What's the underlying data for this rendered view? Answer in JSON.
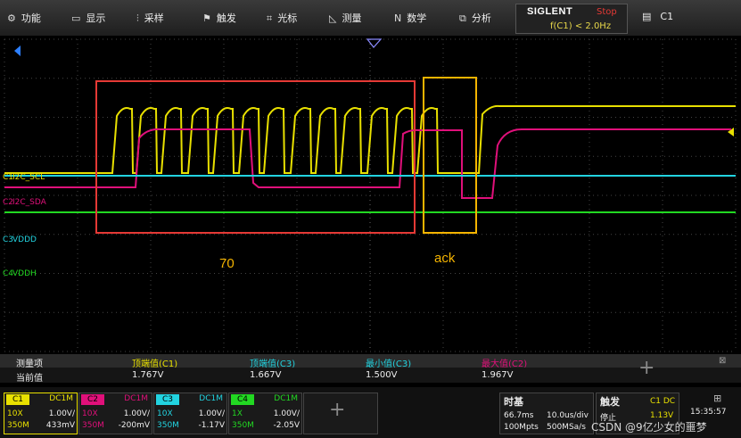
{
  "menu": [
    {
      "label": "功能",
      "icon": "function-icon"
    },
    {
      "label": "显示",
      "icon": "display-icon"
    },
    {
      "label": "采样",
      "icon": "acquire-icon"
    },
    {
      "label": "触发",
      "icon": "trigger-flag-icon"
    },
    {
      "label": "光标",
      "icon": "cursor-icon"
    },
    {
      "label": "测量",
      "icon": "measure-icon"
    },
    {
      "label": "数学",
      "icon": "math-icon"
    },
    {
      "label": "分析",
      "icon": "analysis-icon"
    }
  ],
  "brand": {
    "logo": "SIGLENT",
    "status": "Stop",
    "trigger_info": "f(C1) < 2.0Hz"
  },
  "channel_select": "C1",
  "colors": {
    "c1": "#e8e000",
    "c2": "#e0107a",
    "c3": "#22d3e0",
    "c4": "#22d822",
    "box70": "#e53935",
    "boxack": "#f5b400"
  },
  "channels": [
    {
      "id": "C1",
      "label": "I2C_SCL"
    },
    {
      "id": "C2",
      "label": "I2C_SDA"
    },
    {
      "id": "C3",
      "label": "VDDD"
    },
    {
      "id": "C4",
      "label": "VDDH"
    }
  ],
  "annotations": {
    "box1": "70",
    "box2": "ack"
  },
  "measure": {
    "head_label": "测量项",
    "row_label": "当前值",
    "items": [
      {
        "name": "顶端值(C1)",
        "value": "1.767V",
        "color": "#e8e000"
      },
      {
        "name": "顶端值(C3)",
        "value": "1.667V",
        "color": "#22d3e0"
      },
      {
        "name": "最小值(C3)",
        "value": "1.500V",
        "color": "#22d3e0"
      },
      {
        "name": "最大值(C2)",
        "value": "1.967V",
        "color": "#e0107a"
      }
    ]
  },
  "channel_boxes": [
    {
      "tag": "C1",
      "coupling": "DC1M",
      "probe": "10X",
      "scale": "1.00V/",
      "bw": "350M",
      "offset": "433mV",
      "color": "#e8e000"
    },
    {
      "tag": "C2",
      "coupling": "DC1M",
      "probe": "10X",
      "scale": "1.00V/",
      "bw": "350M",
      "offset": "-200mV",
      "color": "#e0107a"
    },
    {
      "tag": "C3",
      "coupling": "DC1M",
      "probe": "10X",
      "scale": "1.00V/",
      "bw": "350M",
      "offset": "-1.17V",
      "color": "#22d3e0"
    },
    {
      "tag": "C4",
      "coupling": "DC1M",
      "probe": "1X",
      "scale": "1.00V/",
      "bw": "350M",
      "offset": "-2.05V",
      "color": "#22d822"
    }
  ],
  "timebase": {
    "title": "时基",
    "delay": "66.7ms",
    "scale": "10.0us/div",
    "mem": "100Mpts",
    "rate": "500MSa/s"
  },
  "trigger": {
    "title": "触发",
    "source": "C1 DC",
    "state": "停止",
    "level": "1.13V"
  },
  "clock": "15:35:57",
  "watermark": "CSDN @9亿少女的噩梦"
}
